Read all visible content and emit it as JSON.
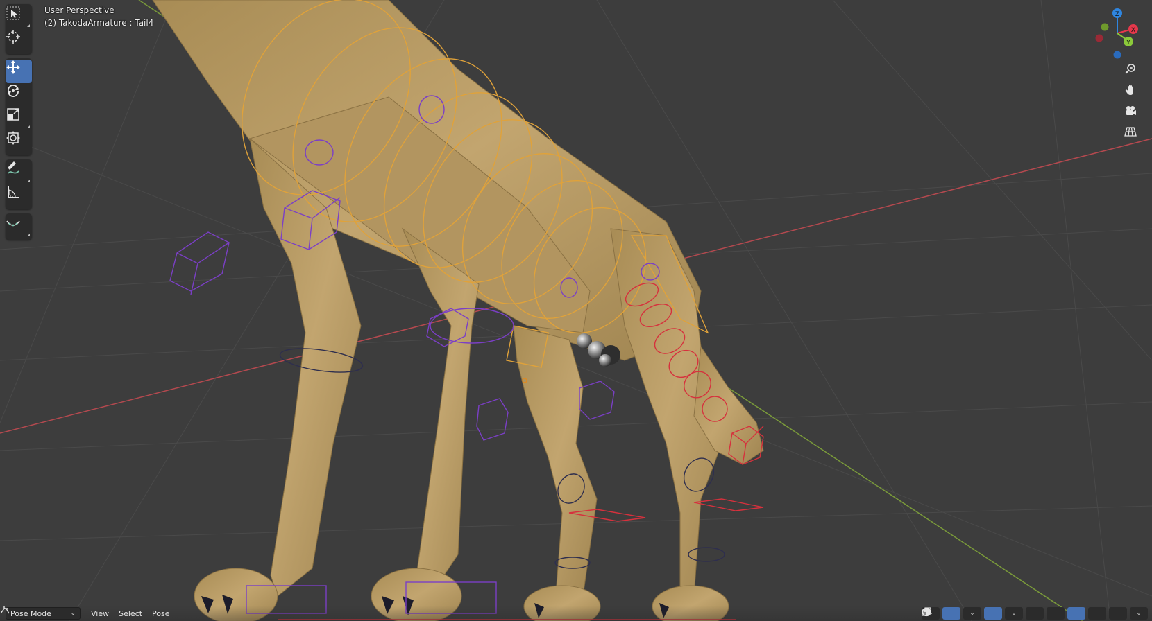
{
  "viewport": {
    "title": "User Perspective",
    "subtitle": "(2) TakodaArmature : Tail4"
  },
  "toolbar": {
    "groups": [
      [
        {
          "name": "select-box-tool",
          "icon": "select-box-icon",
          "active": false
        },
        {
          "name": "cursor-tool",
          "icon": "cursor-icon",
          "active": false
        }
      ],
      [
        {
          "name": "move-tool",
          "icon": "move-icon",
          "active": true
        },
        {
          "name": "rotate-tool",
          "icon": "rotate-icon",
          "active": false
        },
        {
          "name": "scale-tool",
          "icon": "scale-icon",
          "active": false
        },
        {
          "name": "transform-tool",
          "icon": "transform-icon",
          "active": false
        }
      ],
      [
        {
          "name": "annotate-tool",
          "icon": "annotate-icon",
          "active": false
        },
        {
          "name": "measure-tool",
          "icon": "measure-icon",
          "active": false
        }
      ],
      [
        {
          "name": "relax-pose-tool",
          "icon": "pose-relax-icon",
          "active": false
        }
      ]
    ]
  },
  "gizmo": {
    "z_label": "Z",
    "x_label": "X",
    "y_label": "Y",
    "colors": {
      "x": "#e5384b",
      "y": "#8bc93a",
      "z": "#2f86e0"
    }
  },
  "nav_buttons": [
    "zoom-icon",
    "hand-pan-icon",
    "camera-icon",
    "grid-ortho-icon"
  ],
  "header": {
    "mode": "Pose Mode",
    "menus": [
      "View",
      "Select",
      "Pose"
    ]
  },
  "colors": {
    "background": "#3d3d3d",
    "mesh": "#bfa06a",
    "active_tool": "#4772b3",
    "bone_yellow": "#e0a23a",
    "bone_purple": "#7b3fc6",
    "bone_red": "#d6313d"
  }
}
